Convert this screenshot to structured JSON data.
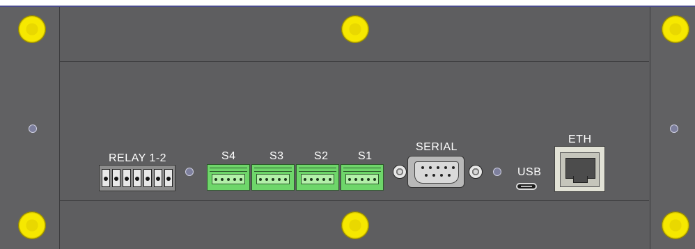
{
  "panel": {
    "labels": {
      "relay": "RELAY 1-2",
      "s4": "S4",
      "s3": "S3",
      "s2": "S2",
      "s1": "S1",
      "serial": "SERIAL",
      "usb": "USB",
      "eth": "ETH"
    },
    "colors": {
      "panel": "#5e5e60",
      "screw": "#f6e800",
      "sensor_connector": "#6ed66a",
      "label_text": "#ffffff"
    },
    "icons": [
      "screw-icon",
      "mounting-hole-icon",
      "terminal-block-icon",
      "db9-connector-icon",
      "usb-port-icon",
      "rj45-port-icon"
    ]
  }
}
